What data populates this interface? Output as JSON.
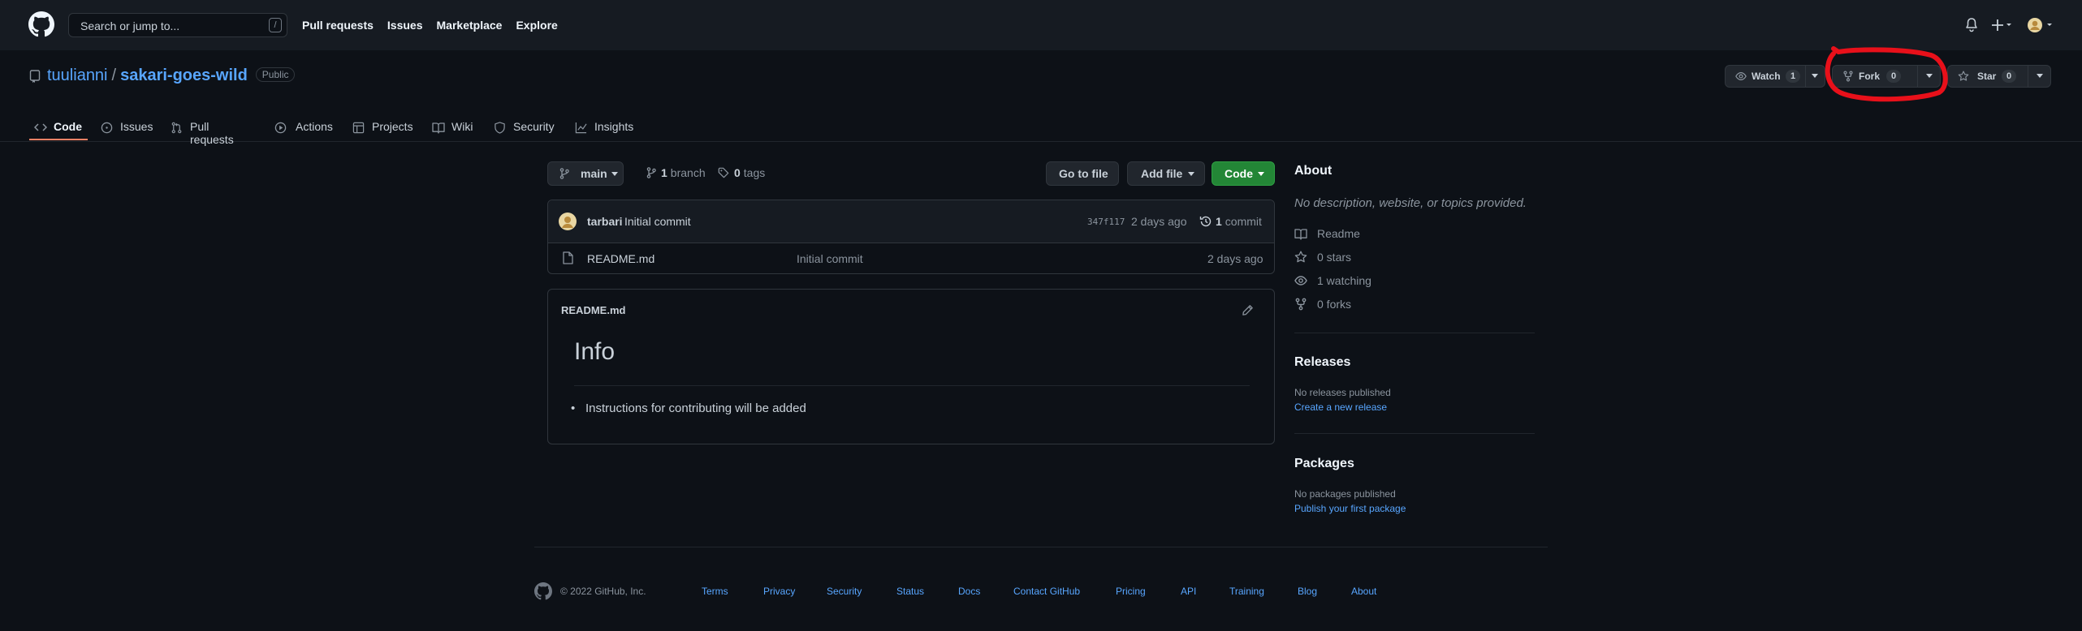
{
  "header": {
    "search_placeholder": "Search or jump to...",
    "search_key": "/",
    "nav": [
      "Pull requests",
      "Issues",
      "Marketplace",
      "Explore"
    ]
  },
  "repo": {
    "owner": "tuulianni",
    "separator": "/",
    "name": "sakari-goes-wild",
    "visibility": "Public",
    "watch": {
      "label": "Watch",
      "count": "1"
    },
    "fork": {
      "label": "Fork",
      "count": "0"
    },
    "star": {
      "label": "Star",
      "count": "0"
    }
  },
  "tabs": [
    "Code",
    "Issues",
    "Pull requests",
    "Actions",
    "Projects",
    "Wiki",
    "Security",
    "Insights"
  ],
  "toolbar": {
    "branch": "main",
    "branches_count": "1",
    "branches_label": "branch",
    "tags_count": "0",
    "tags_label": "tags",
    "go_to_file": "Go to file",
    "add_file": "Add file",
    "code": "Code"
  },
  "commit": {
    "author": "tarbari",
    "message": "Initial commit",
    "sha": "347f117",
    "time": "2 days ago",
    "count": "1",
    "count_label": "commit"
  },
  "files": [
    {
      "name": "README.md",
      "message": "Initial commit",
      "time": "2 days ago"
    }
  ],
  "readme": {
    "filename": "README.md",
    "heading": "Info",
    "bullets": [
      "Instructions for contributing will be added"
    ]
  },
  "about": {
    "title": "About",
    "description": "No description, website, or topics provided.",
    "readme": "Readme",
    "stars": "0 stars",
    "watching": "1 watching",
    "forks": "0 forks"
  },
  "releases": {
    "title": "Releases",
    "empty": "No releases published",
    "link": "Create a new release"
  },
  "packages": {
    "title": "Packages",
    "empty": "No packages published",
    "link": "Publish your first package"
  },
  "footer": {
    "copyright": "© 2022 GitHub, Inc.",
    "links": [
      "Terms",
      "Privacy",
      "Security",
      "Status",
      "Docs",
      "Contact GitHub",
      "Pricing",
      "API",
      "Training",
      "Blog",
      "About"
    ]
  },
  "colors": {
    "bg": "#0d1117",
    "header": "#161b22",
    "link": "#58a6ff",
    "code_button": "#238636",
    "active_tab": "#f78166",
    "annotation": "#e8101a"
  }
}
